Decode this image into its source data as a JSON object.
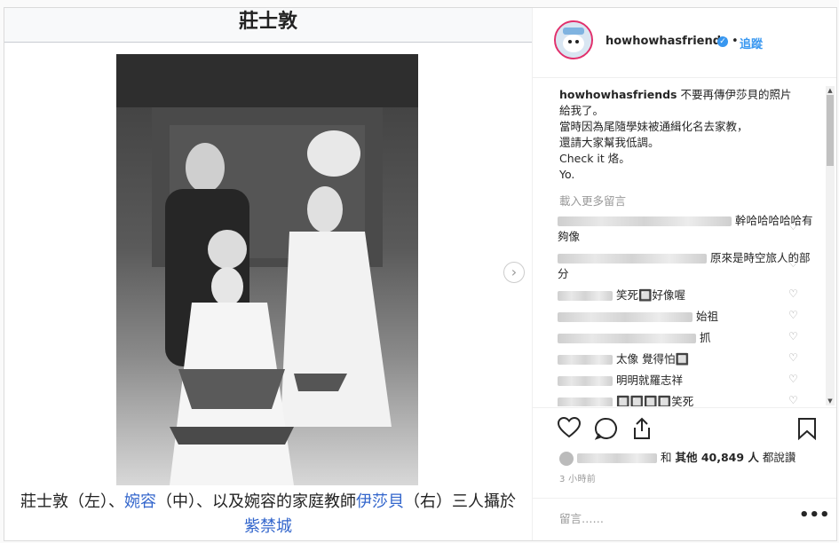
{
  "article": {
    "title": "莊士敦",
    "caption_parts": [
      {
        "text": "莊士敦（左）、",
        "link": false
      },
      {
        "text": "婉容",
        "link": true
      },
      {
        "text": "（中）、以及婉容的家庭教師",
        "link": false
      },
      {
        "text": "伊莎貝",
        "link": true
      },
      {
        "text": "（右）三人攝於",
        "link": false
      },
      {
        "text": "紫禁城",
        "link": true
      }
    ]
  },
  "post": {
    "username": "howhowhasfriends",
    "verified_glyph": "✓",
    "separator": "•",
    "follow_label": "追蹤",
    "caption_user": "howhowhasfriends",
    "caption_lines": [
      "不要再傳伊莎貝的照片給我了。",
      "當時因為尾隨學妹被通緝化名去家教，",
      "還請大家幫我低調。",
      "Check it 烙。",
      "Yo."
    ],
    "load_more": "載入更多留言",
    "comments": [
      {
        "blur_width": 200,
        "text": "幹哈哈哈哈哈有夠像"
      },
      {
        "blur_width": 172,
        "text": "原來是時空旅人的部分"
      },
      {
        "blur_width": 62,
        "text": "笑死🔲好像喔"
      },
      {
        "blur_width": 156,
        "text": "始祖"
      },
      {
        "blur_width": 160,
        "text": "抓"
      },
      {
        "blur_width": 62,
        "text": "太像 覺得怕🔲"
      },
      {
        "blur_width": 62,
        "text": "明明就羅志祥"
      },
      {
        "blur_width": 62,
        "text": "🔲🔲🔲🔲笑死"
      }
    ],
    "likes_prefix": "和",
    "likes_bold": "其他 40,849 人",
    "likes_suffix": "都說讚",
    "time": "3 小時前",
    "add_comment_placeholder": "留言……",
    "more_glyph": "•••",
    "icons": [
      "heart-icon",
      "comment-icon",
      "share-icon",
      "bookmark-icon"
    ],
    "colors": {
      "link": "#3897f0",
      "text": "#262626",
      "muted": "#999999",
      "verified": "#3897f0"
    }
  }
}
